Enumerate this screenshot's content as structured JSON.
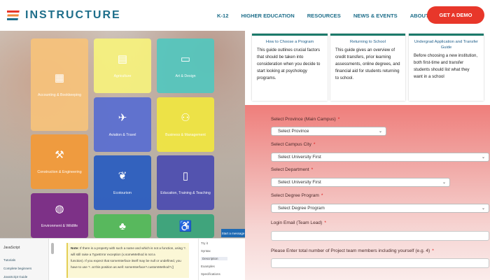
{
  "brand": {
    "name": "INSTRUCTURE"
  },
  "nav": {
    "items": [
      "K-12",
      "HIGHER EDUCATION",
      "RESOURCES",
      "NEWS & EVENTS",
      "ABOUT US"
    ],
    "cta": "GET A DEMO",
    "cta_color": "#e8372a"
  },
  "tiles": [
    {
      "label": "Accounting & Bookkeeping",
      "icon": "calculator-icon",
      "color": "#f6c27b"
    },
    {
      "label": "Agriculture",
      "icon": "document-icon",
      "color": "#f6f27d"
    },
    {
      "label": "Art & Design",
      "icon": "monitor-icon",
      "color": "#52c7be"
    },
    {
      "label": "Aviation & Travel",
      "icon": "airplane-icon",
      "color": "#5b6fd0"
    },
    {
      "label": "Business & Management",
      "icon": "people-chart-icon",
      "color": "#efe542"
    },
    {
      "label": "Construction & Engineering",
      "icon": "worker-icon",
      "color": "#f19a3a"
    },
    {
      "label": "Ecotourism",
      "icon": "leaf-icon",
      "color": "#2e5fbf"
    },
    {
      "label": "Education, Training & Teaching",
      "icon": "phone-person-icon",
      "color": "#4f4fb0"
    },
    {
      "label": "Environment & Wildlife",
      "icon": "globe-icon",
      "color": "#7a2a86"
    },
    {
      "label": "",
      "icon": "plant-icon",
      "color": "#53b85a"
    },
    {
      "label": "",
      "icon": "person-icon",
      "color": "#3aa37a"
    }
  ],
  "doc": {
    "sidebar_title": "JavaScript",
    "sidebar_links": [
      "Tutorials",
      "Complete beginners",
      "JavaScript Guide"
    ],
    "note_label": "Note:",
    "note_lines": [
      "If there is a property with such a name and which is not a function, using ?.",
      "will still raise a TypeError exception (x.someMethod is not a",
      "function). If you expect that someInterface itself may be null or undefined, you",
      "have to use ?. at this position as well: someInterface?.customMethod?.()"
    ],
    "toc": [
      "Try it",
      "Syntax",
      "Description",
      "Examples",
      "Specifications"
    ],
    "toc_selected": 2,
    "chat_button": "Start a message"
  },
  "cards": [
    {
      "title": "How to Choose a Program",
      "body": "This guide outlines crucial factors that should be taken into consideration when you decide to start looking at psychology programs."
    },
    {
      "title": "Returning to School",
      "body": "This guide gives an overview of credit transfers, prior learning assessments, online degrees, and financial aid for students returning to school."
    },
    {
      "title": "Undergrad Application and Transfer Guide",
      "body": "Before choosing a new institution, both first-time and transfer students should list what they want in a school"
    }
  ],
  "form": {
    "province": {
      "label": "Select Province (Main Campus)",
      "value": "Select Province"
    },
    "city": {
      "label": "Select Campus City",
      "value": "Select University First"
    },
    "department": {
      "label": "Select Department",
      "value": "Select University First"
    },
    "degree": {
      "label": "Select Degree Program",
      "value": "Select Degree Program"
    },
    "email": {
      "label": "Login Email (Team Lead)",
      "value": ""
    },
    "members": {
      "label": "Please Enter total number of Project team members including yourself (e.g. 4)",
      "value": ""
    },
    "required_mark": "*"
  }
}
